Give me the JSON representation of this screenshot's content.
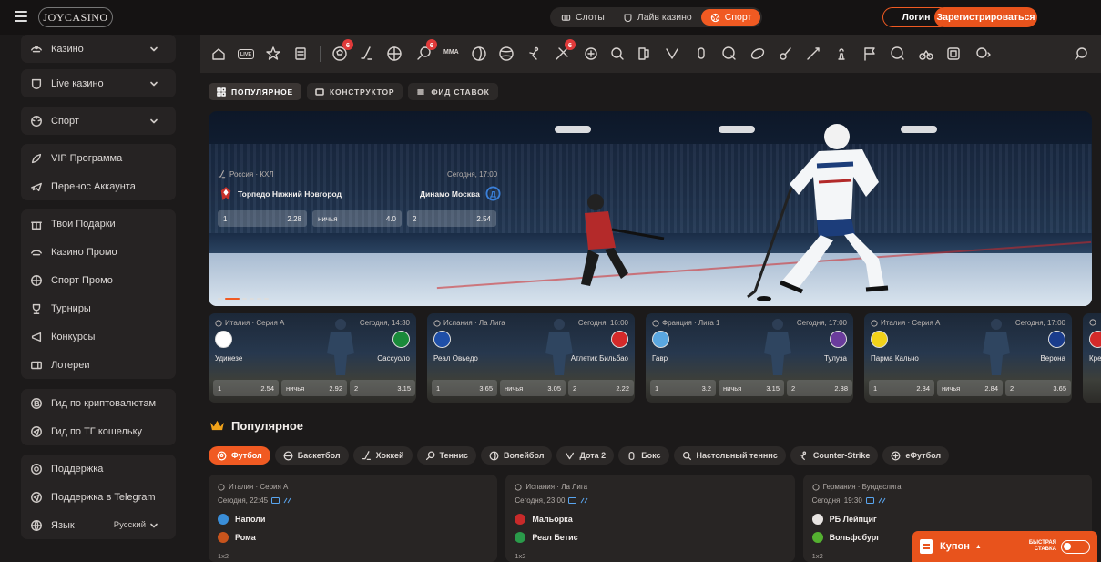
{
  "header": {
    "logo_text": "JOYCASINO",
    "nav_tabs": [
      {
        "label": "Слоты",
        "icon": "slots-icon"
      },
      {
        "label": "Лайв казино",
        "icon": "live-casino-icon"
      },
      {
        "label": "Спорт",
        "icon": "ball-icon",
        "active": true
      }
    ],
    "login_label": "Логин",
    "register_label": "Зарегистрироваться"
  },
  "sidebar": {
    "groups": [
      [
        {
          "label": "Казино",
          "icon": "casino-icon",
          "chevron": true
        }
      ],
      [
        {
          "label": "Live казино",
          "icon": "live-casino-icon",
          "chevron": true
        }
      ],
      [
        {
          "label": "Спорт",
          "icon": "ball-icon",
          "chevron": true
        }
      ],
      [
        {
          "label": "VIP Программа",
          "icon": "vip-icon"
        },
        {
          "label": "Перенос Аккаунта",
          "icon": "plane-icon"
        }
      ],
      [
        {
          "label": "Твои Подарки",
          "icon": "gift-icon"
        },
        {
          "label": "Казино Промо",
          "icon": "casino-promo-icon"
        },
        {
          "label": "Спорт Промо",
          "icon": "sport-promo-icon"
        },
        {
          "label": "Турниры",
          "icon": "trophy-icon"
        },
        {
          "label": "Конкурсы",
          "icon": "contest-icon"
        },
        {
          "label": "Лотереи",
          "icon": "lottery-icon"
        }
      ],
      [
        {
          "label": "Гид по криптовалютам",
          "icon": "crypto-icon"
        },
        {
          "label": "Гид по ТГ кошельку",
          "icon": "telegram-icon"
        }
      ],
      [
        {
          "label": "Поддержка",
          "icon": "support-icon"
        },
        {
          "label": "Поддержка в Telegram",
          "icon": "telegram-support-icon"
        },
        {
          "label": "Язык",
          "icon": "globe-icon",
          "value": "Русский",
          "chevron": true
        }
      ]
    ]
  },
  "sportbar": {
    "live_label": "LIVE",
    "mma_label": "MMA",
    "badges": [
      "6",
      "6",
      "6"
    ]
  },
  "subtabs": [
    {
      "label": "ПОПУЛЯРНОЕ",
      "active": true
    },
    {
      "label": "КОНСТРУКТОР"
    },
    {
      "label": "ФИД СТАВОК"
    }
  ],
  "banner": {
    "league": "Россия · КХЛ",
    "time": "Сегодня, 17:00",
    "home": "Торпедо Нижний Новгород",
    "away": "Динамо Москва",
    "odds": [
      {
        "label": "1",
        "value": "2.28"
      },
      {
        "label": "ничья",
        "value": "4.0"
      },
      {
        "label": "2",
        "value": "2.54"
      }
    ]
  },
  "match_cards": [
    {
      "league": "Италия · Серия А",
      "time": "Сегодня, 14:30",
      "home": "Удинезе",
      "away": "Сассуоло",
      "home_color": "#ffffff",
      "away_color": "#1a8a3a",
      "odds": [
        "2.54",
        "2.92",
        "3.15"
      ]
    },
    {
      "league": "Испания · Ла Лига",
      "time": "Сегодня, 16:00",
      "home": "Реал Овьедо",
      "away": "Атлетик Бильбао",
      "home_color": "#1f4fa8",
      "away_color": "#d42a2a",
      "odds": [
        "3.65",
        "3.05",
        "2.22"
      ]
    },
    {
      "league": "Франция · Лига 1",
      "time": "Сегодня, 17:00",
      "home": "Гавр",
      "away": "Тулуза",
      "home_color": "#5aa7e0",
      "away_color": "#6a3c9c",
      "odds": [
        "3.2",
        "3.15",
        "2.38"
      ]
    },
    {
      "league": "Италия · Серия А",
      "time": "Сегодня, 17:00",
      "home": "Парма Кальчо",
      "away": "Верона",
      "home_color": "#f2d21a",
      "away_color": "#1a3c8c",
      "odds": [
        "2.34",
        "2.84",
        "3.65"
      ]
    },
    {
      "league": "",
      "time": "",
      "home": "Кре",
      "away": "",
      "home_color": "#d42a2a",
      "away_color": "#333333",
      "odds": []
    }
  ],
  "odds_labels": [
    "1",
    "ничья",
    "2"
  ],
  "popular": {
    "title": "Популярное",
    "tabs": [
      {
        "label": "Футбол",
        "active": true
      },
      {
        "label": "Баскетбол"
      },
      {
        "label": "Хоккей"
      },
      {
        "label": "Теннис"
      },
      {
        "label": "Волейбол"
      },
      {
        "label": "Дота 2"
      },
      {
        "label": "Бокс"
      },
      {
        "label": "Настольный теннис"
      },
      {
        "label": "Counter-Strike"
      },
      {
        "label": "еФутбол"
      }
    ],
    "events": [
      {
        "league": "Италия · Серия А",
        "time": "Сегодня, 22:45",
        "home": "Наполи",
        "away": "Рома",
        "market": "1x2",
        "home_color": "#3a8ed8",
        "away_color": "#c8541c"
      },
      {
        "league": "Испания · Ла Лига",
        "time": "Сегодня, 23:00",
        "home": "Мальорка",
        "away": "Реал Бетис",
        "market": "1x2",
        "home_color": "#c82a2a",
        "away_color": "#2a9a4a"
      },
      {
        "league": "Германия · Бундеслига",
        "time": "Сегодня, 19:30",
        "home": "РБ Лейпциг",
        "away": "Вольфсбург",
        "market": "1x2",
        "home_color": "#e8e4e2",
        "away_color": "#54b030"
      }
    ]
  },
  "coupon": {
    "label": "Купон",
    "quick_bet_line1": "БЫСТРАЯ",
    "quick_bet_line2": "СТАВКА"
  }
}
